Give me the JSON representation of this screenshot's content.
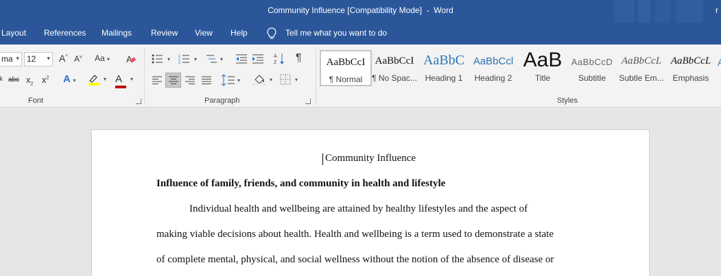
{
  "window": {
    "title": "Community Influence [Compatibility Mode]  -  Word",
    "user_initial": "r"
  },
  "menu": {
    "tabs": [
      "Layout",
      "References",
      "Mailings",
      "Review",
      "View",
      "Help"
    ],
    "tell_me": "Tell me what you want to do"
  },
  "ribbon": {
    "font": {
      "name": "ma",
      "size": "12",
      "group_label": "Font"
    },
    "paragraph": {
      "group_label": "Paragraph"
    },
    "styles": {
      "group_label": "Styles",
      "items": [
        {
          "sample": "AaBbCcI",
          "name": "¶ Normal"
        },
        {
          "sample": "AaBbCcI",
          "name": "¶ No Spac..."
        },
        {
          "sample": "AaBbC",
          "name": "Heading 1"
        },
        {
          "sample": "AaBbCcl",
          "name": "Heading 2"
        },
        {
          "sample": "AaB",
          "name": "Title"
        },
        {
          "sample": "AaBbCcD",
          "name": "Subtitle"
        },
        {
          "sample": "AaBbCcL",
          "name": "Subtle Em..."
        },
        {
          "sample": "AaBbCcL",
          "name": "Emphasis"
        }
      ]
    },
    "labels": {
      "grow_font": "A",
      "shrink_font": "A",
      "change_case": "Aa",
      "strikethrough": "abc",
      "subscript": "x",
      "superscript": "x",
      "font_color": "A",
      "text_effects": "A",
      "show_marks": "¶"
    }
  },
  "colors": {
    "accent": "#2b579a",
    "highlight": "#ffff00",
    "font_color": "#c00000"
  },
  "document": {
    "title": "Community Influence",
    "heading": "Influence of family, friends, and community in health and lifestyle",
    "lines": [
      "Individual health and wellbeing are attained by healthy lifestyles and the aspect of",
      "making viable decisions about health. Health and wellbeing is a term used to demonstrate a state",
      "of complete mental, physical, and social wellness without the notion of the absence of disease or"
    ]
  }
}
